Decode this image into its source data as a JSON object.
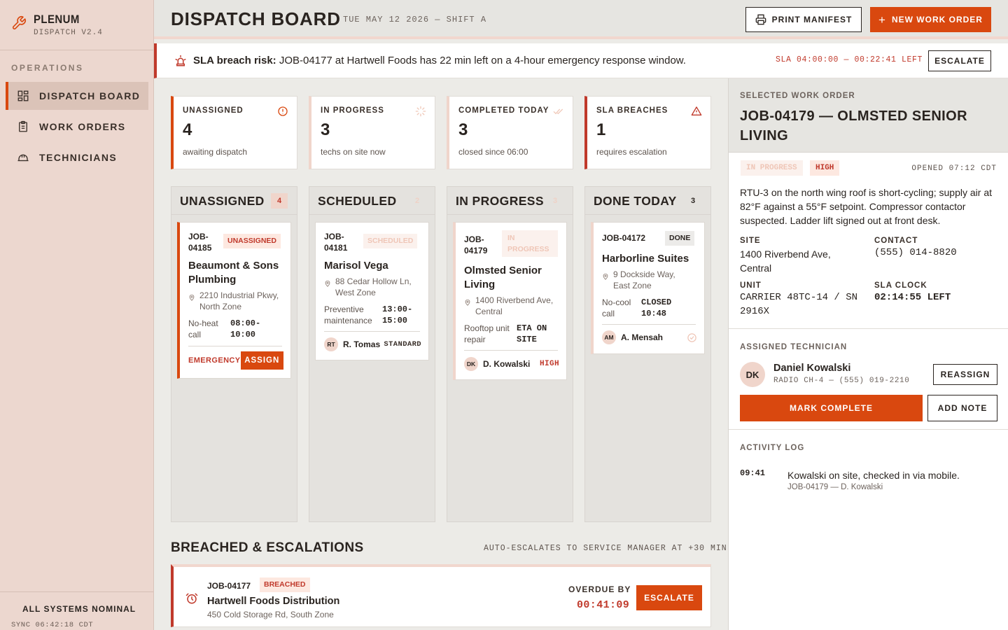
{
  "app": {
    "name": "PLENUM",
    "version": "DISPATCH V2.4"
  },
  "sidebar": {
    "section": "OPERATIONS",
    "items": [
      {
        "label": "DISPATCH BOARD",
        "icon": "board-icon",
        "active": true
      },
      {
        "label": "WORK ORDERS",
        "icon": "clipboard-icon",
        "active": false
      },
      {
        "label": "TECHNICIANS",
        "icon": "hardhat-icon",
        "active": false
      }
    ],
    "status": "ALL SYSTEMS NOMINAL",
    "sync": "SYNC 06:42:18 CDT"
  },
  "header": {
    "title": "DISPATCH BOARD",
    "date": "TUE MAY 12 2026 — SHIFT A",
    "print_label": "PRINT MANIFEST",
    "new_label": "NEW WORK ORDER"
  },
  "alert": {
    "prefix": "SLA breach risk:",
    "message": "JOB-04177 at Hartwell Foods has 22 min left on a 4-hour emergency response window.",
    "sla": "SLA 04:00:00 — 00:22:41 LEFT",
    "action": "ESCALATE"
  },
  "stats": [
    {
      "label": "UNASSIGNED",
      "value": "4",
      "sub": "awaiting dispatch",
      "icon": "alert-circle-icon"
    },
    {
      "label": "IN PROGRESS",
      "value": "3",
      "sub": "techs on site now",
      "icon": "spinner-icon"
    },
    {
      "label": "COMPLETED TODAY",
      "value": "3",
      "sub": "closed since 06:00",
      "icon": "double-check-icon"
    },
    {
      "label": "SLA BREACHES",
      "value": "1",
      "sub": "requires escalation",
      "icon": "warning-triangle-icon"
    }
  ],
  "columns": [
    {
      "title": "UNASSIGNED",
      "count": "4",
      "card": {
        "id": "JOB-04185",
        "badge": "UNASSIGNED",
        "name": "Beaumont & Sons Plumbing",
        "address": "2210 Industrial Pkwy, North Zone",
        "type": "No-heat call",
        "time": "08:00-10:00",
        "priority": "EMERGENCY",
        "action": "ASSIGN"
      }
    },
    {
      "title": "SCHEDULED",
      "count": "2",
      "card": {
        "id": "JOB-04181",
        "badge": "SCHEDULED",
        "name": "Marisol Vega",
        "address": "88 Cedar Hollow Ln, West Zone",
        "type": "Preventive maintenance",
        "time": "13:00-15:00",
        "tech_initials": "RT",
        "tech": "R. Tomas",
        "priority": "STANDARD"
      }
    },
    {
      "title": "IN PROGRESS",
      "count": "3",
      "card": {
        "id": "JOB-04179",
        "badge": "IN PROGRESS",
        "name": "Olmsted Senior Living",
        "address": "1400 Riverbend Ave, Central",
        "type": "Rooftop unit repair",
        "time": "ETA ON SITE",
        "tech_initials": "DK",
        "tech": "D. Kowalski",
        "priority": "HIGH"
      }
    },
    {
      "title": "DONE TODAY",
      "count": "3",
      "card": {
        "id": "JOB-04172",
        "badge": "DONE",
        "name": "Harborline Suites",
        "address": "9 Dockside Way, East Zone",
        "type": "No-cool call",
        "time": "CLOSED 10:48",
        "tech_initials": "AM",
        "tech": "A. Mensah"
      }
    }
  ],
  "breached": {
    "title": "BREACHED & ESCALATIONS",
    "note": "AUTO-ESCALATES TO SERVICE MANAGER AT +30 MIN",
    "item": {
      "id": "JOB-04177",
      "badge": "BREACHED",
      "name": "Hartwell Foods Distribution",
      "address": "450 Cold Storage Rd, South Zone",
      "overdue_label": "OVERDUE BY",
      "overdue": "00:41:09",
      "action": "ESCALATE"
    }
  },
  "detail": {
    "section": "SELECTED WORK ORDER",
    "title": "JOB-04179 — OLMSTED SENIOR LIVING",
    "status": "IN PROGRESS",
    "priority": "HIGH",
    "opened": "OPENED 07:12 CDT",
    "description": "RTU-3 on the north wing roof is short-cycling; supply air at 82°F against a 55°F setpoint. Compressor contactor suspected. Ladder lift signed out at front desk.",
    "site_label": "SITE",
    "site": "1400 Riverbend Ave, Central",
    "contact_label": "CONTACT",
    "contact": "(555) 014-8820",
    "unit_label": "UNIT",
    "unit": "CARRIER 48TC-14 / SN 2916X",
    "sla_label": "SLA CLOCK",
    "sla": "02:14:55 LEFT",
    "tech_section": "ASSIGNED TECHNICIAN",
    "tech_initials": "DK",
    "tech_name": "Daniel Kowalski",
    "tech_sub": "RADIO CH-4 — (555) 019-2210",
    "reassign": "REASSIGN",
    "complete": "MARK COMPLETE",
    "note": "ADD NOTE",
    "log_section": "ACTIVITY LOG",
    "log": [
      {
        "time": "09:41",
        "text": "Kowalski on site, checked in via mobile.",
        "sub": "JOB-04179 — D. Kowalski"
      }
    ]
  },
  "colors": {
    "accent": "#d9480f",
    "danger": "#c0392b",
    "sidebar": "#ecd7cf",
    "accent_soft": "#f0d5cb"
  }
}
